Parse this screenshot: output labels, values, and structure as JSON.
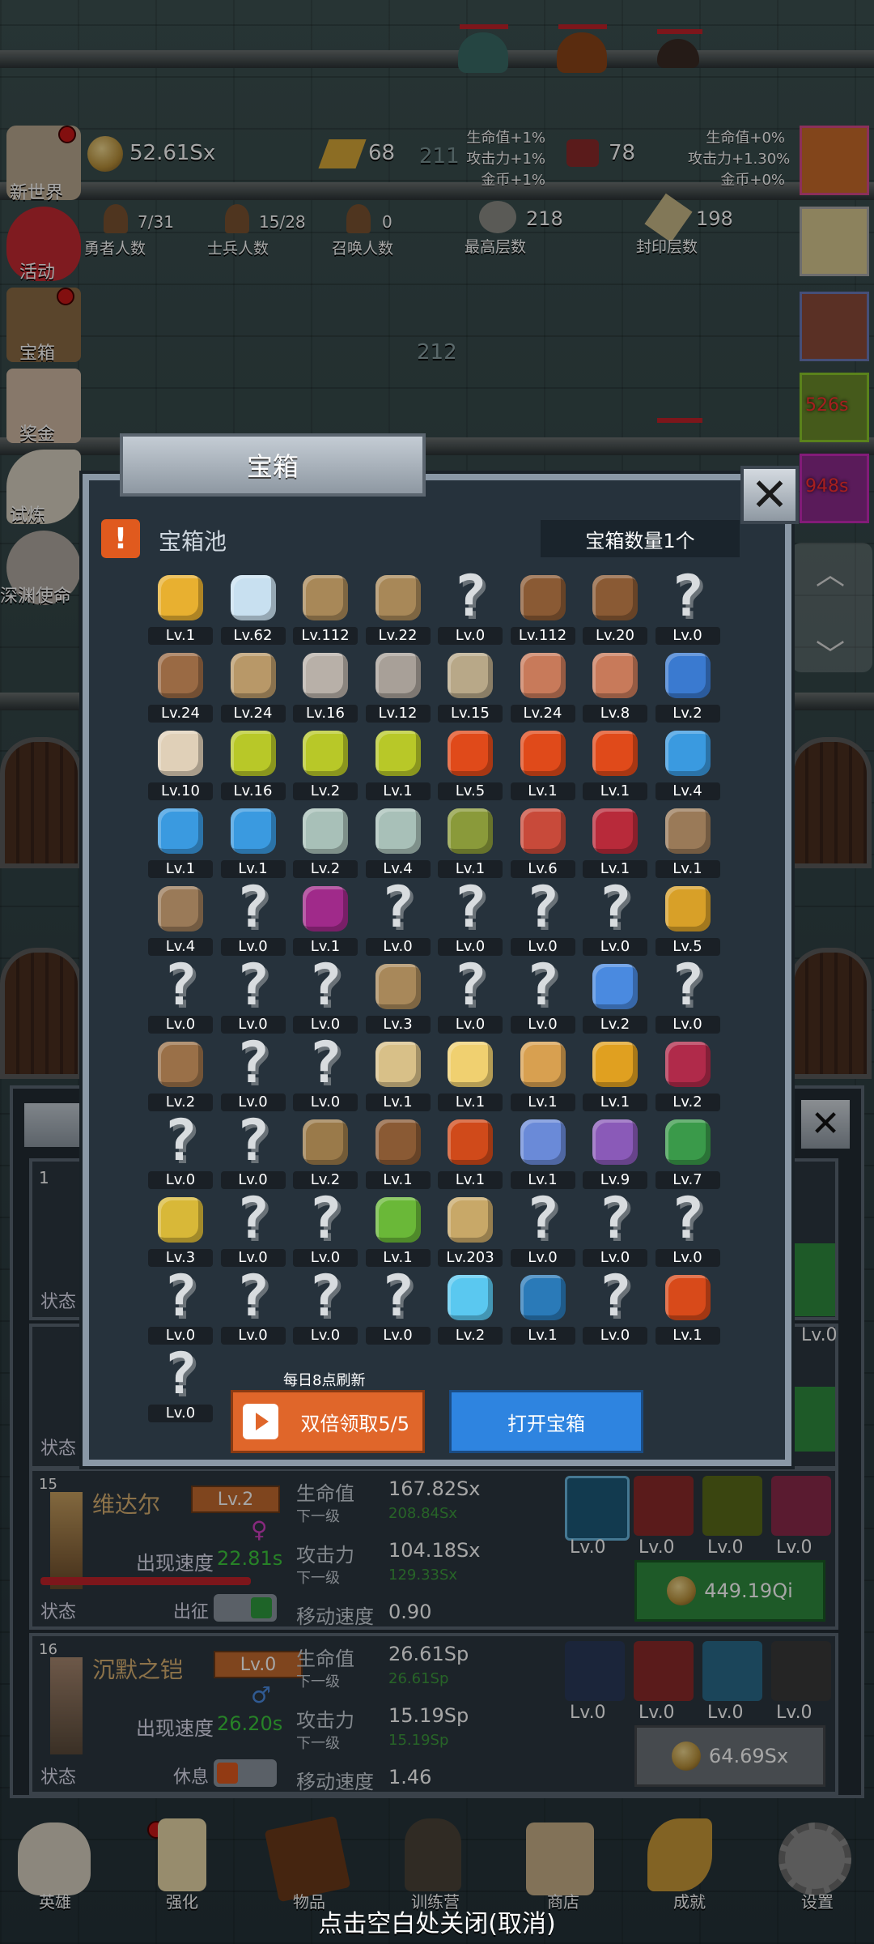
{
  "hud": {
    "gold": "52.61Sx",
    "gold_bars": "68",
    "meat": "78",
    "floor_current": "211",
    "left_bonus": [
      "生命值+1%",
      "攻击力+1%",
      "金币+1%"
    ],
    "right_bonus": [
      "生命值+0%",
      "攻击力+1.30%",
      "金币+0%"
    ],
    "counters": [
      {
        "value": "7/31",
        "label": "勇者人数"
      },
      {
        "value": "15/28",
        "label": "士兵人数"
      },
      {
        "value": "0",
        "label": "召唤人数"
      },
      {
        "value": "218",
        "label": "最高层数"
      },
      {
        "value": "198",
        "label": "封印层数"
      }
    ],
    "floor_below": "212"
  },
  "left_menu": [
    "新世界",
    "活动",
    "宝箱",
    "奖金",
    "试炼",
    "深渊使命"
  ],
  "right_timers": [
    "526s",
    "948s"
  ],
  "modal": {
    "title": "宝箱",
    "pool_label": "宝箱池",
    "chest_count": "宝箱数量1个",
    "refresh_note": "每日8点刷新",
    "double_button": "双倍领取5/5",
    "open_button": "打开宝箱",
    "items": [
      {
        "icon": "crown-icon",
        "lv": "Lv.1"
      },
      {
        "icon": "diamond-icon",
        "lv": "Lv.62"
      },
      {
        "icon": "sword-icon",
        "lv": "Lv.112"
      },
      {
        "icon": "sword-icon",
        "lv": "Lv.22"
      },
      {
        "icon": "unknown-icon",
        "lv": "Lv.0"
      },
      {
        "icon": "armor-icon",
        "lv": "Lv.112"
      },
      {
        "icon": "armor-icon",
        "lv": "Lv.20"
      },
      {
        "icon": "unknown-icon",
        "lv": "Lv.0"
      },
      {
        "icon": "helmet-icon",
        "lv": "Lv.24"
      },
      {
        "icon": "dagger-icon",
        "lv": "Lv.24"
      },
      {
        "icon": "knight-helmet-icon",
        "lv": "Lv.16"
      },
      {
        "icon": "hammer-icon",
        "lv": "Lv.12"
      },
      {
        "icon": "great-helm-icon",
        "lv": "Lv.15"
      },
      {
        "icon": "ham-icon",
        "lv": "Lv.24"
      },
      {
        "icon": "steak-icon",
        "lv": "Lv.8"
      },
      {
        "icon": "bag-icon",
        "lv": "Lv.2"
      },
      {
        "icon": "bread-icon",
        "lv": "Lv.10"
      },
      {
        "icon": "yellow-potion-icon",
        "lv": "Lv.16"
      },
      {
        "icon": "yellow-potion-icon",
        "lv": "Lv.2"
      },
      {
        "icon": "yellow-potion-icon",
        "lv": "Lv.1"
      },
      {
        "icon": "red-potion-icon",
        "lv": "Lv.5"
      },
      {
        "icon": "red-potion-icon",
        "lv": "Lv.1"
      },
      {
        "icon": "red-potion-icon",
        "lv": "Lv.1"
      },
      {
        "icon": "blue-potion-icon",
        "lv": "Lv.4"
      },
      {
        "icon": "blue-potion-icon",
        "lv": "Lv.1"
      },
      {
        "icon": "blue-potion-icon",
        "lv": "Lv.1"
      },
      {
        "icon": "gray-potion-icon",
        "lv": "Lv.2"
      },
      {
        "icon": "gray-potion-icon",
        "lv": "Lv.4"
      },
      {
        "icon": "olive-bottle-icon",
        "lv": "Lv.1"
      },
      {
        "icon": "red-bottle-icon",
        "lv": "Lv.6"
      },
      {
        "icon": "winged-boot-icon",
        "lv": "Lv.1"
      },
      {
        "icon": "boot-icon",
        "lv": "Lv.1"
      },
      {
        "icon": "boot-icon",
        "lv": "Lv.4"
      },
      {
        "icon": "unknown-icon",
        "lv": "Lv.0"
      },
      {
        "icon": "magic-boot-icon",
        "lv": "Lv.1"
      },
      {
        "icon": "unknown-icon",
        "lv": "Lv.0"
      },
      {
        "icon": "unknown-icon",
        "lv": "Lv.0"
      },
      {
        "icon": "unknown-icon",
        "lv": "Lv.0"
      },
      {
        "icon": "unknown-icon",
        "lv": "Lv.0"
      },
      {
        "icon": "torch-icon",
        "lv": "Lv.5"
      },
      {
        "icon": "unknown-icon",
        "lv": "Lv.0"
      },
      {
        "icon": "unknown-icon",
        "lv": "Lv.0"
      },
      {
        "icon": "unknown-icon",
        "lv": "Lv.0"
      },
      {
        "icon": "staff-icon",
        "lv": "Lv.3"
      },
      {
        "icon": "unknown-icon",
        "lv": "Lv.0"
      },
      {
        "icon": "unknown-icon",
        "lv": "Lv.0"
      },
      {
        "icon": "wand-icon",
        "lv": "Lv.2"
      },
      {
        "icon": "unknown-icon",
        "lv": "Lv.0"
      },
      {
        "icon": "backpack-icon",
        "lv": "Lv.2"
      },
      {
        "icon": "unknown-icon",
        "lv": "Lv.0"
      },
      {
        "icon": "unknown-icon",
        "lv": "Lv.0"
      },
      {
        "icon": "club-icon",
        "lv": "Lv.1"
      },
      {
        "icon": "cheese-icon",
        "lv": "Lv.1"
      },
      {
        "icon": "pie-icon",
        "lv": "Lv.1"
      },
      {
        "icon": "jar-icon",
        "lv": "Lv.1"
      },
      {
        "icon": "crystal-icon",
        "lv": "Lv.2"
      },
      {
        "icon": "unknown-icon",
        "lv": "Lv.0"
      },
      {
        "icon": "unknown-icon",
        "lv": "Lv.0"
      },
      {
        "icon": "bow-icon",
        "lv": "Lv.2"
      },
      {
        "icon": "quiver-icon",
        "lv": "Lv.1"
      },
      {
        "icon": "fire-glove-icon",
        "lv": "Lv.1"
      },
      {
        "icon": "blue-glove-icon",
        "lv": "Lv.1"
      },
      {
        "icon": "purple-glove-icon",
        "lv": "Lv.9"
      },
      {
        "icon": "amulet-icon",
        "lv": "Lv.7"
      },
      {
        "icon": "scroll-icon",
        "lv": "Lv.3"
      },
      {
        "icon": "unknown-icon",
        "lv": "Lv.0"
      },
      {
        "icon": "unknown-icon",
        "lv": "Lv.0"
      },
      {
        "icon": "green-wand-icon",
        "lv": "Lv.1"
      },
      {
        "icon": "beer-mug-icon",
        "lv": "Lv.203"
      },
      {
        "icon": "unknown-icon",
        "lv": "Lv.0"
      },
      {
        "icon": "unknown-icon",
        "lv": "Lv.0"
      },
      {
        "icon": "unknown-icon",
        "lv": "Lv.0"
      },
      {
        "icon": "unknown-icon",
        "lv": "Lv.0"
      },
      {
        "icon": "unknown-icon",
        "lv": "Lv.0"
      },
      {
        "icon": "unknown-icon",
        "lv": "Lv.0"
      },
      {
        "icon": "unknown-icon",
        "lv": "Lv.0"
      },
      {
        "icon": "crystal-ball-icon",
        "lv": "Lv.2"
      },
      {
        "icon": "rune-orb-icon",
        "lv": "Lv.1"
      },
      {
        "icon": "unknown-icon",
        "lv": "Lv.0"
      },
      {
        "icon": "fire-staff-icon",
        "lv": "Lv.1"
      },
      {
        "icon": "unknown-icon",
        "lv": "Lv.0"
      }
    ]
  },
  "hero_cards_partial": [
    {
      "number": "1",
      "status_label": "状态"
    },
    {
      "status_label": "状态"
    }
  ],
  "hero_cards": [
    {
      "number": "15",
      "name": "维达尔",
      "level": "Lv.2",
      "gender": "♀",
      "speed_label": "出现速度",
      "speed": "22.81s",
      "hp_label": "生命值",
      "hp": "167.82Sx",
      "hp_next_label": "下一级",
      "hp_next": "208.84Sx",
      "atk_label": "攻击力",
      "atk": "104.18Sx",
      "atk_next_label": "下一级",
      "atk_next": "129.33Sx",
      "move_label": "移动速度",
      "move": "0.90",
      "status_label": "状态",
      "state_label": "出征",
      "skills": [
        "Lv.0",
        "Lv.0",
        "Lv.0",
        "Lv.0"
      ],
      "cost": "449.19Qi",
      "cost_color": "#2e8a3e"
    },
    {
      "number": "16",
      "name": "沉默之铠",
      "level": "Lv.0",
      "gender": "♂",
      "speed_label": "出现速度",
      "speed": "26.20s",
      "hp_label": "生命值",
      "hp": "26.61Sp",
      "hp_next_label": "下一级",
      "hp_next": "26.61Sp",
      "atk_label": "攻击力",
      "atk": "15.19Sp",
      "atk_next_label": "下一级",
      "atk_next": "15.19Sp",
      "move_label": "移动速度",
      "move": "1.46",
      "status_label": "状态",
      "state_label": "休息",
      "skills": [
        "Lv.0",
        "Lv.0",
        "Lv.0",
        "Lv.0"
      ],
      "cost": "64.69Sx",
      "cost_color": "#6c7278"
    }
  ],
  "side_partial": {
    "right_level": "Lv.0"
  },
  "bottom_nav": [
    "英雄",
    "强化",
    "物品",
    "训练营",
    "商店",
    "成就",
    "设置"
  ],
  "close_hint": "点击空白处关闭(取消)",
  "colors": {
    "accent_orange": "#e0662a",
    "accent_blue": "#2e84e0",
    "panel": "#26323c",
    "green_text": "#3c9a3c"
  }
}
